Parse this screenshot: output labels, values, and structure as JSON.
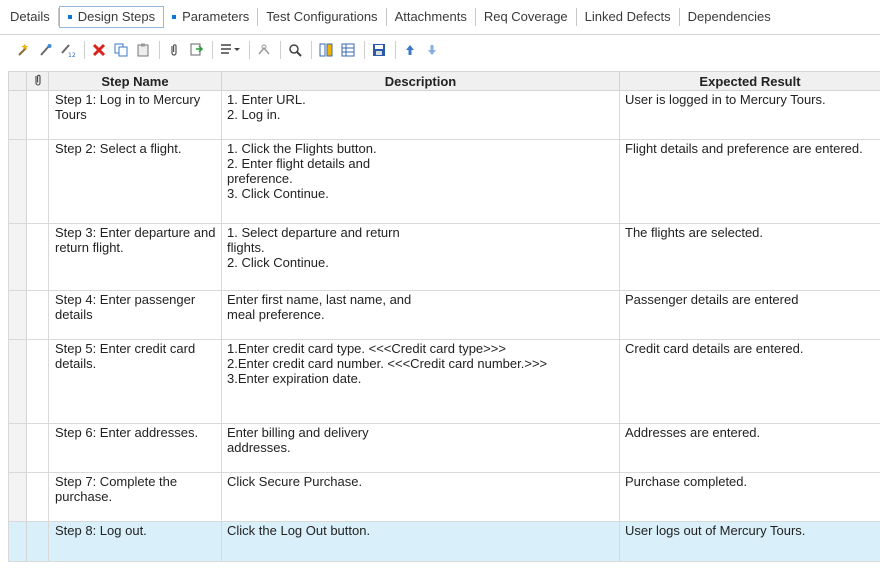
{
  "tabs": [
    {
      "label": "Details",
      "active": false,
      "marked": false
    },
    {
      "label": "Design Steps",
      "active": true,
      "marked": true
    },
    {
      "label": "Parameters",
      "active": false,
      "marked": true
    },
    {
      "label": "Test Configurations",
      "active": false,
      "marked": false
    },
    {
      "label": "Attachments",
      "active": false,
      "marked": false
    },
    {
      "label": "Req Coverage",
      "active": false,
      "marked": false
    },
    {
      "label": "Linked Defects",
      "active": false,
      "marked": false
    },
    {
      "label": "Dependencies",
      "active": false,
      "marked": false
    }
  ],
  "toolbar": {
    "icons": [
      "new-step-icon",
      "edit-step-icon",
      "renumber-steps-icon",
      "delete-icon",
      "copy-icon",
      "paste-icon",
      "attachment-icon",
      "call-test-icon",
      "insert-parameter-icon",
      "find-icon",
      "search-icon",
      "select-columns-icon",
      "grid-filter-icon",
      "save-icon",
      "move-up-icon",
      "move-down-icon"
    ]
  },
  "grid": {
    "columns": {
      "step_name": "Step Name",
      "description": "Description",
      "expected": "Expected Result"
    },
    "rows": [
      {
        "name": "Step 1:  Log in to Mercury Tours",
        "description": [
          "1. Enter URL.",
          "2. Log in."
        ],
        "expected": "User is logged in to Mercury Tours.",
        "selected": false
      },
      {
        "name": "Step 2: Select a flight.",
        "description": [
          "1. Click the Flights button.",
          "2. Enter flight details and",
          "preference.",
          "3. Click Continue."
        ],
        "expected": "Flight details and preference are entered.",
        "selected": false
      },
      {
        "name": "Step 3: Enter departure and return flight.",
        "description": [
          "1. Select departure and return",
          "flights.",
          "2. Click Continue."
        ],
        "expected": "The flights are selected.",
        "selected": false
      },
      {
        "name": "Step 4: Enter passenger details",
        "description": [
          "Enter first name, last name, and",
          "meal preference."
        ],
        "expected": "Passenger details are entered",
        "selected": false
      },
      {
        "name": "Step 5: Enter credit card details.",
        "description": [
          "1.Enter credit card type. <<<Credit card type>>>",
          "2.Enter credit card number. <<<Credit card number.>>>",
          "3.Enter expiration date."
        ],
        "expected": "Credit card details are entered.",
        "selected": false
      },
      {
        "name": "Step 6: Enter addresses.",
        "description": [
          "Enter billing and delivery",
          "addresses."
        ],
        "expected": "Addresses are entered.",
        "selected": false
      },
      {
        "name": "Step 7: Complete the purchase.",
        "description": [
          "Click Secure Purchase."
        ],
        "expected": "Purchase completed.",
        "selected": false
      },
      {
        "name": "Step 8: Log out.",
        "description": [
          "Click the Log Out button."
        ],
        "expected": "User logs out of Mercury Tours.",
        "selected": true
      }
    ]
  },
  "colors": {
    "accent": "#0a78d4",
    "selected_row": "#d9effa",
    "delete_red": "#d9221c"
  }
}
